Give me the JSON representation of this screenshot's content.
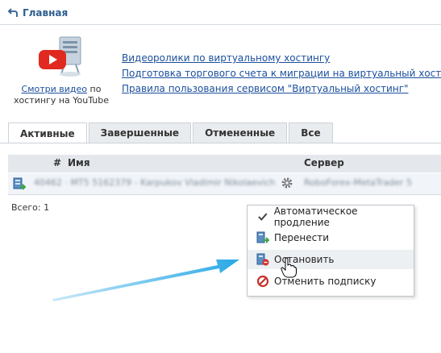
{
  "header": {
    "breadcrumb": "Главная"
  },
  "promo": {
    "caption_link": "Смотри видео",
    "caption_rest": " по хостингу на YouTube",
    "links": [
      "Видеоролики по виртуальному хостингу",
      "Подготовка торгового счета к миграции на виртуальный хостинг",
      "Правила пользования сервисом \"Виртуальный хостинг\""
    ]
  },
  "tabs": [
    {
      "label": "Активные",
      "active": true
    },
    {
      "label": "Завершенные",
      "active": false
    },
    {
      "label": "Отмененные",
      "active": false
    },
    {
      "label": "Все",
      "active": false
    }
  ],
  "table": {
    "columns": {
      "num": "#",
      "name": "Имя",
      "server": "Сервер"
    },
    "rows": [
      {
        "name": "40462 · MT5 5162379 - Karpukov Vladimir Nikolaevich",
        "server": "RoboForex-MetaTrader 5"
      }
    ],
    "total": "Всего: 1"
  },
  "context_menu": {
    "items": [
      {
        "label": "Автоматическое продление",
        "icon": "checkmark-icon"
      },
      {
        "label": "Перенести",
        "icon": "transfer-icon"
      },
      {
        "label": "Остановить",
        "icon": "stop-icon",
        "hover": true
      },
      {
        "label": "Отменить подписку",
        "icon": "cancel-icon"
      }
    ]
  },
  "colors": {
    "link": "#1b4f9c",
    "arrow": "#29a8e6",
    "cancel": "#c8302a"
  }
}
